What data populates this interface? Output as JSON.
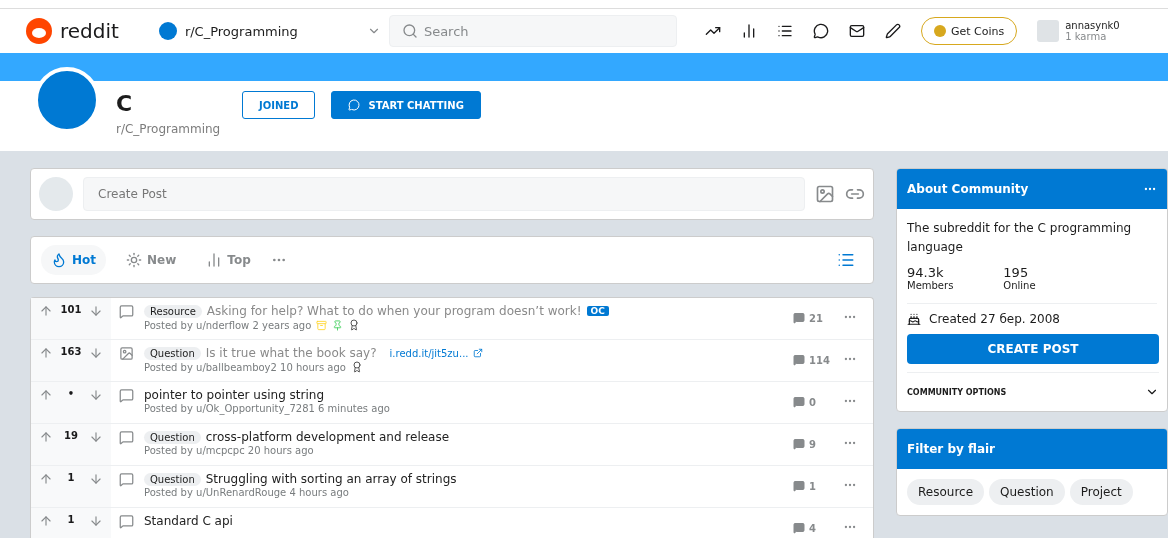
{
  "header": {
    "logo": "reddit",
    "community": "r/C_Programming",
    "search": {
      "placeholder": "Search"
    },
    "coins": "Get Coins",
    "user": {
      "name": "annasynk0",
      "karma": "1 karma"
    }
  },
  "community": {
    "letter": "C",
    "name": "r/C_Programming",
    "joined": "JOINED",
    "chat": "START CHATTING"
  },
  "create_post": {
    "placeholder": "Create Post"
  },
  "sort_tabs": [
    {
      "label": "Hot",
      "kind": "hot",
      "selected": true
    },
    {
      "label": "New",
      "kind": "new",
      "selected": false
    },
    {
      "label": "Top",
      "kind": "top",
      "selected": false
    }
  ],
  "posts": [
    {
      "kind": "text",
      "votes": "101",
      "flair": "Resource",
      "title": "Asking for help? What to do when your program doesn’t work!",
      "visited": true,
      "badge": "OC",
      "meta": "Posted by u/nderflow 2 years ago",
      "pinned": true,
      "awarded": true,
      "comments": "21"
    },
    {
      "kind": "image",
      "votes": "163",
      "flair": "Question",
      "title": "Is it true what the book say?",
      "visited": true,
      "link": "i.redd.it/jit5zu...",
      "meta": "Posted by u/ballbeamboy2 10 hours ago",
      "pinned": false,
      "awarded": true,
      "comments": "114"
    },
    {
      "kind": "text",
      "votes": "•",
      "title": "pointer to pointer using string",
      "visited": false,
      "meta": "Posted by u/Ok_Opportunity_7281 6 minutes ago",
      "pinned": false,
      "awarded": false,
      "comments": "0"
    },
    {
      "kind": "text",
      "votes": "19",
      "flair": "Question",
      "title": "cross-platform development and release",
      "visited": false,
      "meta": "Posted by u/mcpcpc 20 hours ago",
      "pinned": false,
      "awarded": false,
      "comments": "9"
    },
    {
      "kind": "text",
      "votes": "1",
      "flair": "Question",
      "title": "Struggling with sorting an array of strings",
      "visited": false,
      "meta": "Posted by u/UnRenardRouge 4 hours ago",
      "pinned": false,
      "awarded": false,
      "comments": "1"
    },
    {
      "kind": "text",
      "votes": "1",
      "title": "Standard C api",
      "visited": false,
      "pinned": false,
      "awarded": false,
      "comments": "4"
    }
  ],
  "about": {
    "title": "About Community",
    "description": "The subreddit for the C programming language",
    "stats": [
      {
        "value": "94.3k",
        "label": "Members"
      },
      {
        "value": "195",
        "label": "Online"
      }
    ],
    "created": "Created 27 бер. 2008",
    "button": "CREATE POST",
    "options": "COMMUNITY OPTIONS"
  },
  "flair_filter": {
    "title": "Filter by flair",
    "flairs": [
      "Resource",
      "Question",
      "Project"
    ]
  }
}
